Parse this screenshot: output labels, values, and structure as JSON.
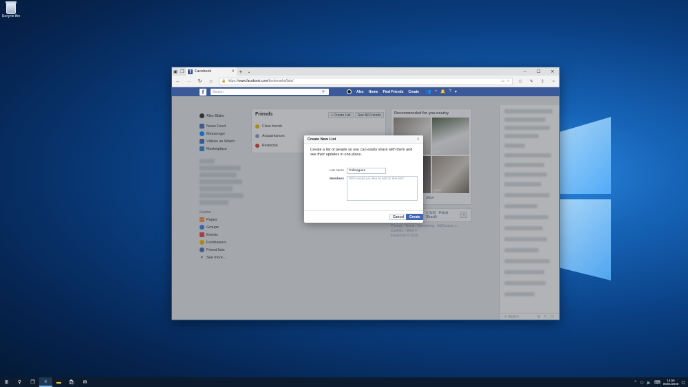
{
  "desktop": {
    "recycle_bin_label": "Recycle Bin"
  },
  "browser": {
    "tab_title": "Facebook",
    "url_prefix": "https://",
    "url_domain": "www.facebook.com",
    "url_path": "/bookmarks/lists/"
  },
  "fb_header": {
    "search_placeholder": "Search",
    "user_name": "Alex",
    "home": "Home",
    "find_friends": "Find Friends",
    "create": "Create"
  },
  "left_nav": {
    "profile_name": "Alex Blake",
    "items": [
      "News Feed",
      "Messenger",
      "Videos on Watch",
      "Marketplace"
    ],
    "explore_heading": "Explore",
    "explore_items": [
      "Pages",
      "Groups",
      "Events",
      "Fundraisers",
      "Friend lists"
    ],
    "see_more": "See more..."
  },
  "friends_card": {
    "title": "Friends",
    "create_list": "+ Create List",
    "see_all": "See All Friends",
    "lists": [
      "Close friends",
      "Acquaintances",
      "Restricted"
    ]
  },
  "recommended": {
    "title": "Recommended for you nearby",
    "price_1": "£50",
    "price_2": "£180",
    "partial_label": "place"
  },
  "languages_partial": {
    "line1": "h (US) · Polski",
    "line2": "(Brasil)"
  },
  "footer_links": {
    "line1": "Privacy · Terms · Advertising · AdChoices ▷",
    "line2": "Cookies · More ▾",
    "line3": "Facebook © 2020"
  },
  "chat": {
    "search_placeholder": "Search"
  },
  "dialog": {
    "title": "Create New List",
    "description": "Create a list of people so you can easily share with them and see their updates in one place.",
    "list_name_label": "List name",
    "list_name_value": "Colleagues",
    "members_label": "Members",
    "members_placeholder": "Who would you like to add to this list?",
    "cancel": "Cancel",
    "create": "Create"
  },
  "taskbar": {
    "time": "14:55",
    "date": "06/01/2020"
  },
  "colors": {
    "facebook_blue": "#3b5998",
    "button_blue": "#4267b2"
  }
}
